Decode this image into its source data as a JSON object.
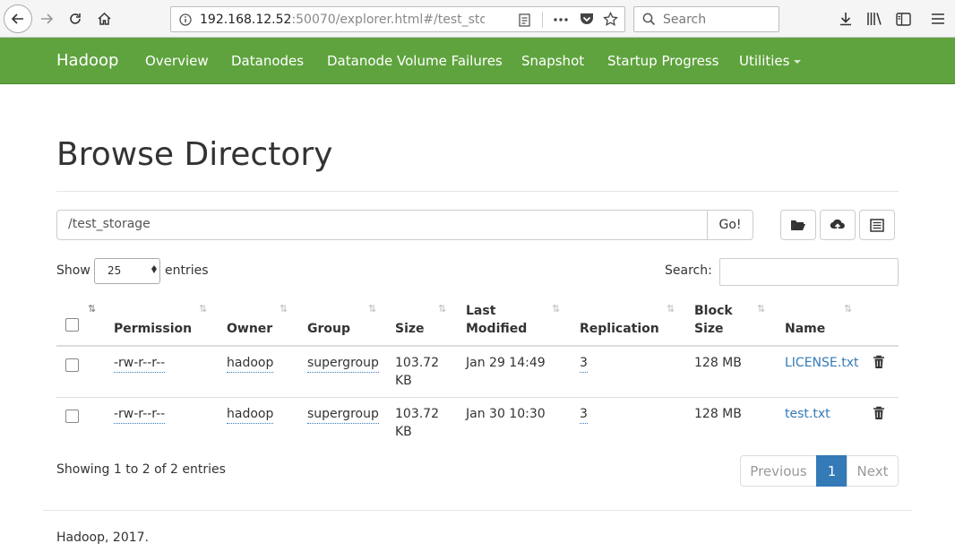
{
  "browser": {
    "url_host": "192.168.12.52",
    "url_rest": ":50070/explorer.html#/test_stor",
    "search_placeholder": "Search"
  },
  "navbar": {
    "brand": "Hadoop",
    "links": [
      "Overview",
      "Datanodes",
      "Datanode Volume Failures",
      "Snapshot",
      "Startup Progress",
      "Utilities"
    ]
  },
  "page": {
    "title": "Browse Directory",
    "path_value": "/test_storage",
    "go_label": "Go!",
    "show_label": "Show",
    "entries_value": "25",
    "entries_label": "entries",
    "search_label": "Search:"
  },
  "table": {
    "headers": {
      "permission": "Permission",
      "owner": "Owner",
      "group": "Group",
      "size": "Size",
      "last_modified_1": "Last",
      "last_modified_2": "Modified",
      "replication": "Replication",
      "block_size_1": "Block",
      "block_size_2": "Size",
      "name": "Name"
    },
    "rows": [
      {
        "permission": "-rw-r--r--",
        "owner": "hadoop",
        "group": "supergroup",
        "size_1": "103.72",
        "size_2": "KB",
        "modified": "Jan 29 14:49",
        "replication": "3",
        "block_size": "128 MB",
        "name": "LICENSE.txt"
      },
      {
        "permission": "-rw-r--r--",
        "owner": "hadoop",
        "group": "supergroup",
        "size_1": "103.72",
        "size_2": "KB",
        "modified": "Jan 30 10:30",
        "replication": "3",
        "block_size": "128 MB",
        "name": "test.txt"
      }
    ]
  },
  "pagination": {
    "summary": "Showing 1 to 2 of 2 entries",
    "previous": "Previous",
    "current": "1",
    "next": "Next"
  },
  "footer": {
    "text": "Hadoop, 2017."
  },
  "colors": {
    "navbar": "#5fa33e",
    "link": "#337ab7",
    "active_page": "#337ab7"
  }
}
